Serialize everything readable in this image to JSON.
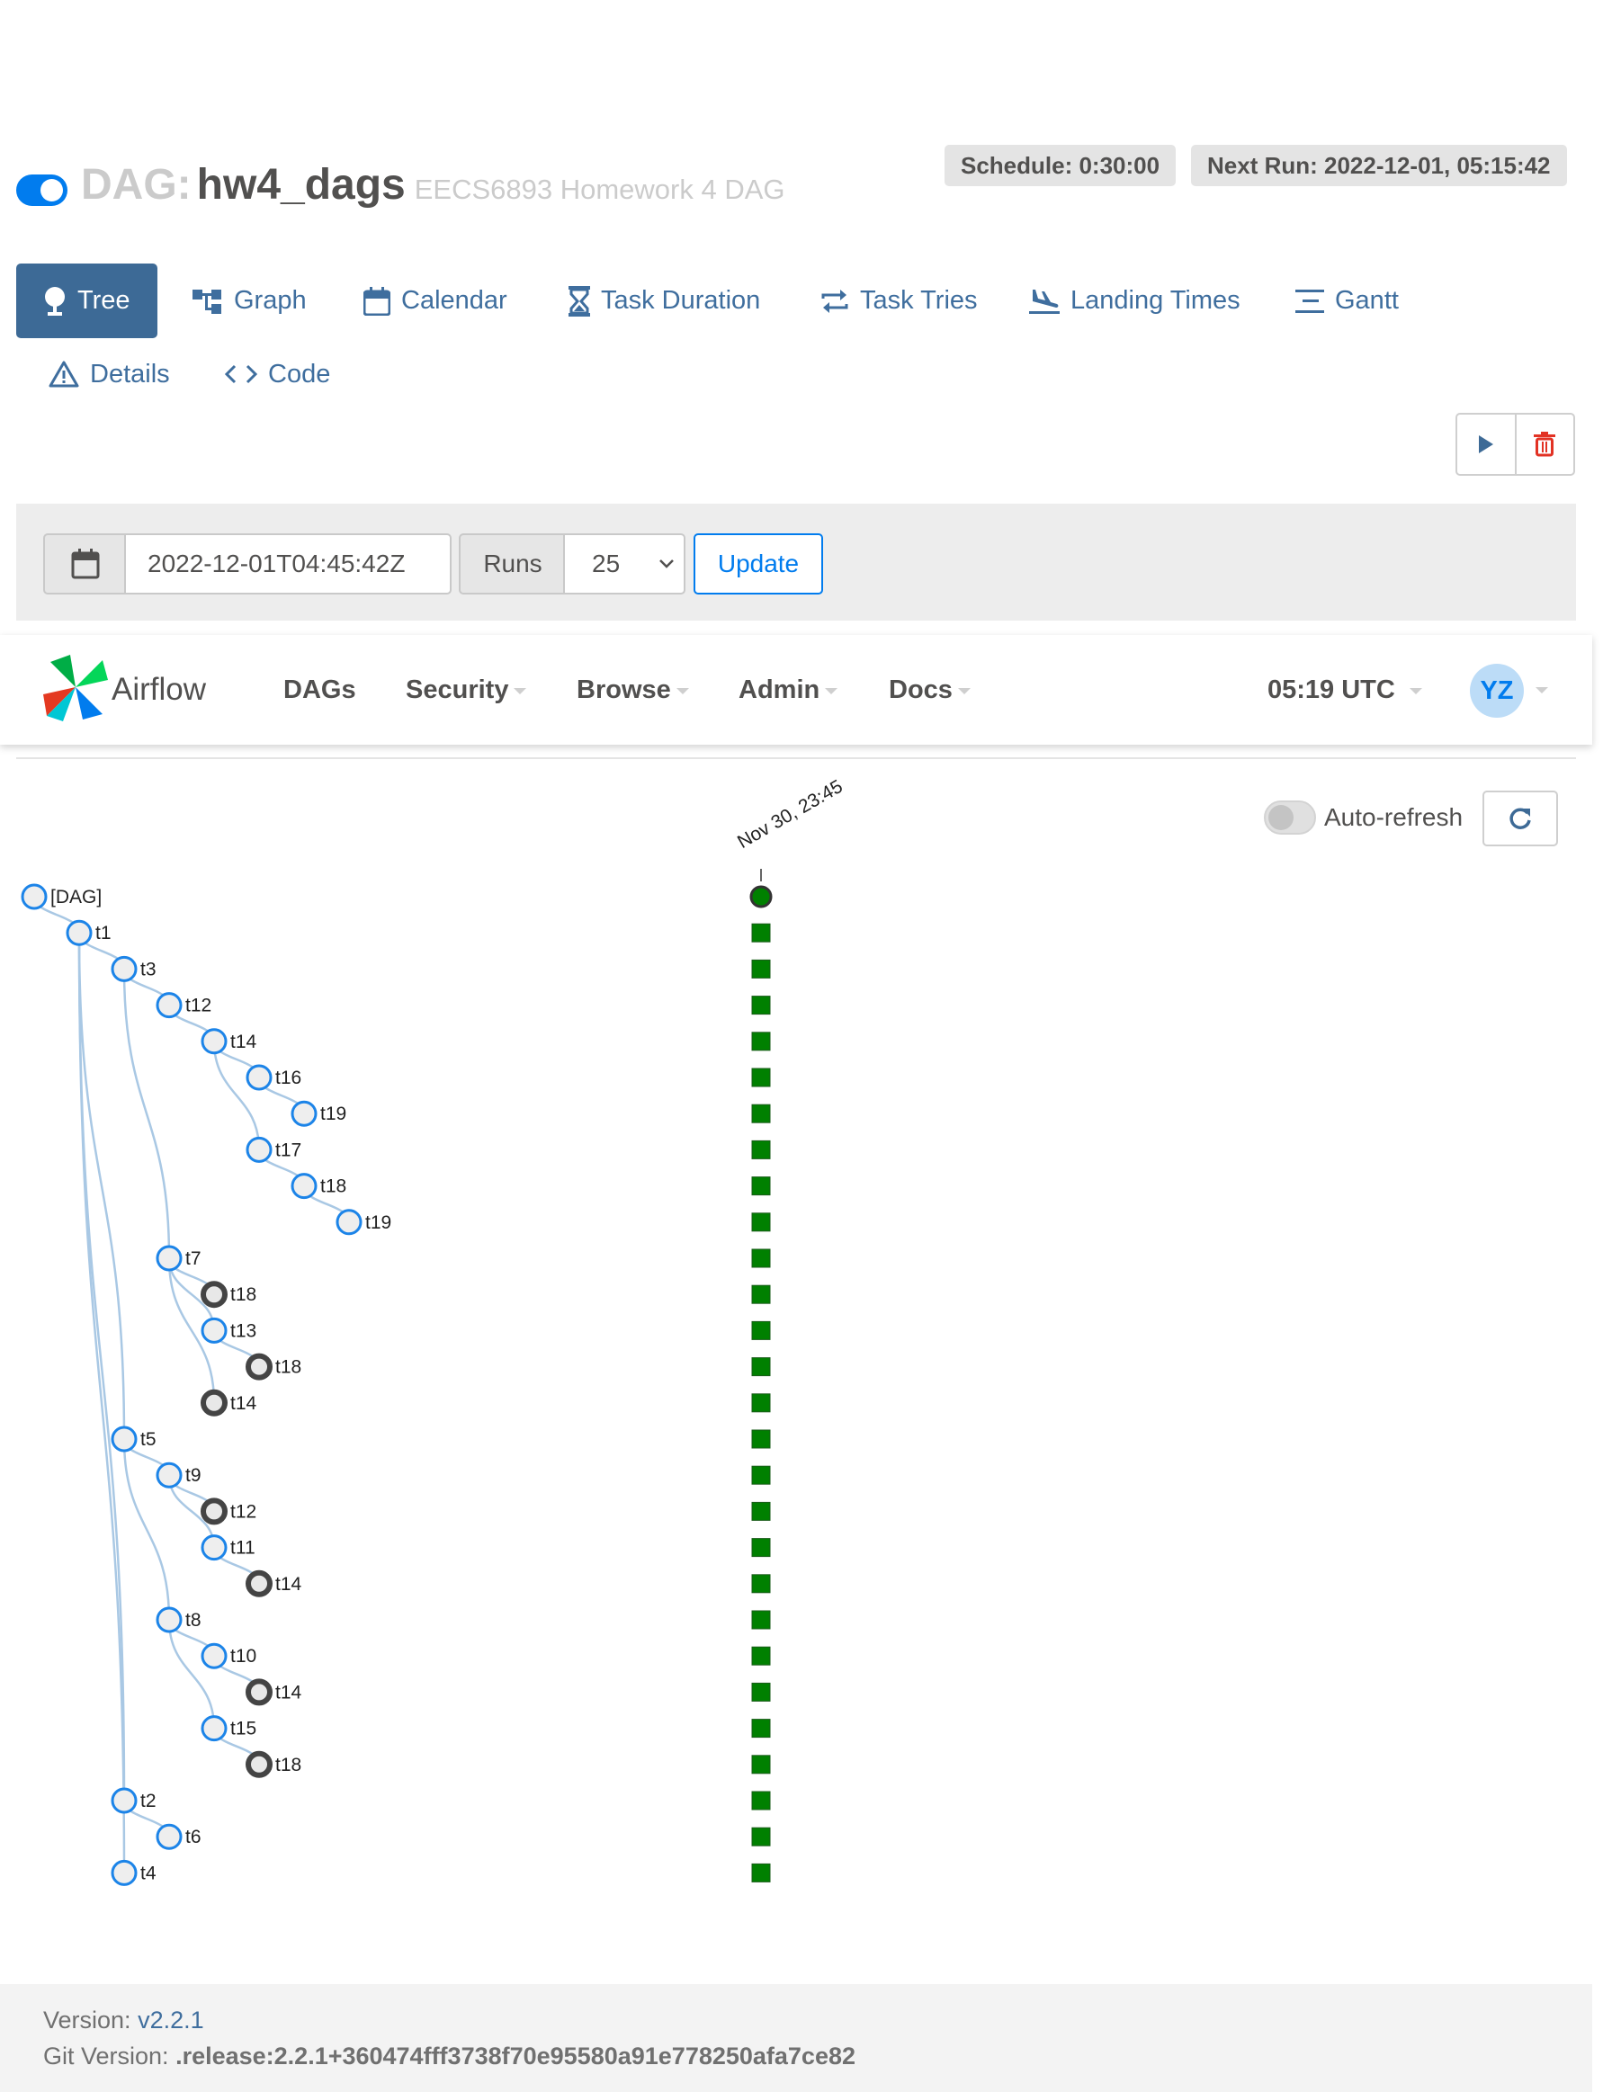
{
  "dag": {
    "prefix": "DAG:",
    "name": "hw4_dags",
    "description": "EECS6893 Homework 4 DAG",
    "paused": false,
    "schedule": "Schedule: 0:30:00",
    "next_run": "Next Run: 2022-12-01, 05:15:42"
  },
  "views": [
    {
      "label": "Tree",
      "icon": "tree-icon",
      "active": true
    },
    {
      "label": "Graph",
      "icon": "graph-icon"
    },
    {
      "label": "Calendar",
      "icon": "calendar-icon"
    },
    {
      "label": "Task Duration",
      "icon": "hourglass-icon"
    },
    {
      "label": "Task Tries",
      "icon": "repeat-icon"
    },
    {
      "label": "Landing Times",
      "icon": "plane-landing-icon"
    },
    {
      "label": "Gantt",
      "icon": "gantt-icon"
    },
    {
      "label": "Details",
      "icon": "warning-triangle-icon"
    },
    {
      "label": "Code",
      "icon": "code-icon"
    }
  ],
  "actions": {
    "trigger": "play-icon",
    "delete": "trash-icon"
  },
  "filter": {
    "base_date": "2022-12-01T04:45:42Z",
    "runs_label": "Runs",
    "runs_value": "25",
    "update_label": "Update"
  },
  "navbar": {
    "brand": "Airflow",
    "items": [
      "DAGs",
      "Security",
      "Browse",
      "Admin",
      "Docs"
    ],
    "time": "05:19 UTC",
    "user_initials": "YZ"
  },
  "auto_refresh": {
    "label": "Auto-refresh",
    "enabled": false
  },
  "tree": {
    "run_date": "Nov 30, 23:45",
    "run_state_color": "#008000",
    "nodes": [
      {
        "label": "[DAG]",
        "depth": 0,
        "type": "dag"
      },
      {
        "label": "t1",
        "depth": 1
      },
      {
        "label": "t3",
        "depth": 2
      },
      {
        "label": "t12",
        "depth": 3
      },
      {
        "label": "t14",
        "depth": 4
      },
      {
        "label": "t16",
        "depth": 5
      },
      {
        "label": "t19",
        "depth": 6
      },
      {
        "label": "t17",
        "depth": 5
      },
      {
        "label": "t18",
        "depth": 6
      },
      {
        "label": "t19",
        "depth": 7
      },
      {
        "label": "t7",
        "depth": 3
      },
      {
        "label": "t18",
        "depth": 4,
        "collapsed": true
      },
      {
        "label": "t13",
        "depth": 4
      },
      {
        "label": "t18",
        "depth": 5,
        "collapsed": true
      },
      {
        "label": "t14",
        "depth": 4,
        "collapsed": true
      },
      {
        "label": "t5",
        "depth": 2
      },
      {
        "label": "t9",
        "depth": 3
      },
      {
        "label": "t12",
        "depth": 4,
        "collapsed": true
      },
      {
        "label": "t11",
        "depth": 4
      },
      {
        "label": "t14",
        "depth": 5,
        "collapsed": true
      },
      {
        "label": "t8",
        "depth": 3
      },
      {
        "label": "t10",
        "depth": 4
      },
      {
        "label": "t14",
        "depth": 5,
        "collapsed": true
      },
      {
        "label": "t15",
        "depth": 4
      },
      {
        "label": "t18",
        "depth": 5,
        "collapsed": true
      },
      {
        "label": "t2",
        "depth": 2
      },
      {
        "label": "t6",
        "depth": 3
      },
      {
        "label": "t4",
        "depth": 2
      }
    ],
    "edges": [
      [
        0,
        1
      ],
      [
        1,
        2
      ],
      [
        2,
        3
      ],
      [
        3,
        4
      ],
      [
        4,
        5
      ],
      [
        5,
        6
      ],
      [
        4,
        7
      ],
      [
        7,
        8
      ],
      [
        8,
        9
      ],
      [
        2,
        10
      ],
      [
        10,
        11
      ],
      [
        10,
        12
      ],
      [
        12,
        13
      ],
      [
        10,
        14
      ],
      [
        1,
        15
      ],
      [
        15,
        16
      ],
      [
        16,
        17
      ],
      [
        16,
        18
      ],
      [
        18,
        19
      ],
      [
        15,
        20
      ],
      [
        20,
        21
      ],
      [
        21,
        22
      ],
      [
        20,
        23
      ],
      [
        23,
        24
      ],
      [
        1,
        25
      ],
      [
        25,
        26
      ],
      [
        1,
        27
      ]
    ]
  },
  "footer": {
    "version_label": "Version:",
    "version": "v2.2.1",
    "git_label": "Git Version:",
    "git": ".release:2.2.1+360474fff3738f70e95580a91e778250afa7ce82"
  }
}
